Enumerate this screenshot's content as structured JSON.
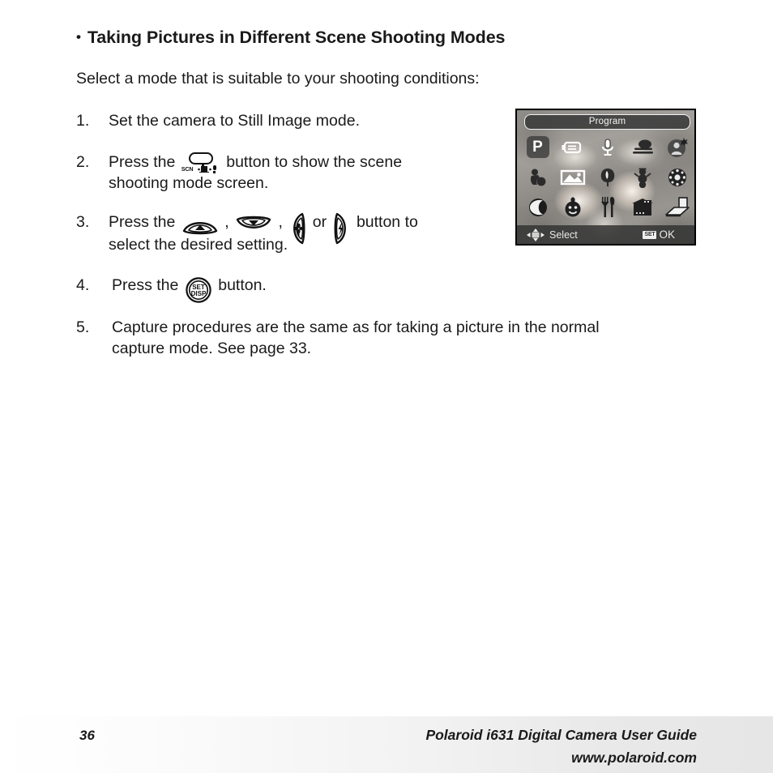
{
  "heading": {
    "bullet": "•",
    "text": "Taking Pictures in Different Scene Shooting Modes"
  },
  "intro": "Select a mode that is suitable to your shooting conditions:",
  "steps": [
    {
      "number": "1.",
      "lines": [
        "Set the camera to Still Image mode."
      ]
    },
    {
      "number": "2.",
      "pre": "Press the",
      "icons": [
        "scn-mode-button-icon"
      ],
      "post": "button to show the scene",
      "line2": "shooting mode screen."
    },
    {
      "number": "3.",
      "pre": "Press the",
      "sep1": ",",
      "sep2": ",",
      "or": "or",
      "post": "button to",
      "line2": "select the desired setting."
    },
    {
      "number": "4.",
      "pre": "Press the",
      "post": "button."
    },
    {
      "number": "5.",
      "lines": [
        "Capture procedures are the same as for taking a picture in the normal",
        "capture mode. See page 33."
      ]
    }
  ],
  "button_icons": {
    "scn_label": "SCN",
    "set_top": "SET",
    "set_bottom": "DISP"
  },
  "lcd": {
    "title": "Program",
    "status_select": "Select",
    "status_ok": "OK",
    "status_set_badge": "SET",
    "selected_mode": "Program",
    "modes": [
      {
        "id": "program",
        "label": "P",
        "name": "program-mode-icon",
        "selected": true
      },
      {
        "id": "movie",
        "label": "",
        "name": "movie-mode-icon",
        "selected": false
      },
      {
        "id": "voice",
        "label": "",
        "name": "voice-record-mode-icon",
        "selected": false
      },
      {
        "id": "panorama",
        "label": "",
        "name": "panorama-mode-icon",
        "selected": false
      },
      {
        "id": "portrait",
        "label": "",
        "name": "portrait-mode-icon",
        "selected": false
      },
      {
        "id": "sports",
        "label": "",
        "name": "sports-mode-icon",
        "selected": false
      },
      {
        "id": "landscape",
        "label": "",
        "name": "landscape-mode-icon",
        "selected": false
      },
      {
        "id": "sunset",
        "label": "",
        "name": "sunset-mode-icon",
        "selected": false
      },
      {
        "id": "snow",
        "label": "",
        "name": "snow-mode-icon",
        "selected": false
      },
      {
        "id": "fireworks",
        "label": "",
        "name": "fireworks-mode-icon",
        "selected": false
      },
      {
        "id": "night",
        "label": "",
        "name": "night-scene-mode-icon",
        "selected": false
      },
      {
        "id": "children",
        "label": "",
        "name": "children-mode-icon",
        "selected": false
      },
      {
        "id": "food",
        "label": "",
        "name": "food-mode-icon",
        "selected": false
      },
      {
        "id": "building",
        "label": "",
        "name": "building-mode-icon",
        "selected": false
      },
      {
        "id": "text",
        "label": "",
        "name": "text-mode-icon",
        "selected": false
      }
    ]
  },
  "footer": {
    "page_number": "36",
    "guide_title": "Polaroid i631 Digital Camera User Guide",
    "url": "www.polaroid.com"
  },
  "colors": {
    "text": "#1a1a1a",
    "lcd_overlay": "#3a3a3a",
    "lcd_text": "#f2f2f2",
    "footer_gradient_end": "#e6e6e6"
  }
}
